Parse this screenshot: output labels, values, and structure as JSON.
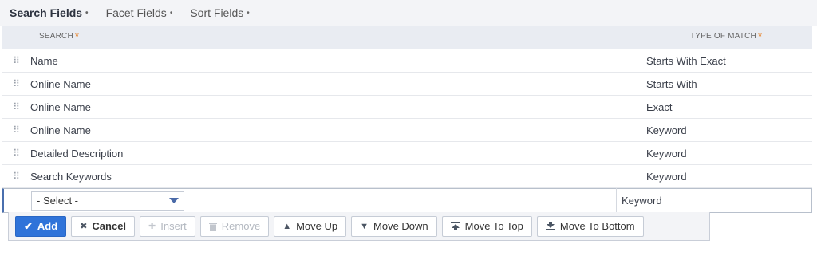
{
  "tabs": [
    {
      "label": "Search Fields",
      "active": true
    },
    {
      "label": "Facet Fields",
      "active": false
    },
    {
      "label": "Sort Fields",
      "active": false
    }
  ],
  "tab_dot": "•",
  "columns": {
    "search": "SEARCH",
    "type_of_match": "TYPE OF MATCH",
    "required_marker": "*"
  },
  "rows": [
    {
      "search": "Name",
      "type": "Starts With Exact"
    },
    {
      "search": "Online Name",
      "type": "Starts With"
    },
    {
      "search": "Online Name",
      "type": "Exact"
    },
    {
      "search": "Online Name",
      "type": "Keyword"
    },
    {
      "search": "Detailed Description",
      "type": "Keyword"
    },
    {
      "search": "Search Keywords",
      "type": "Keyword"
    }
  ],
  "edit_row": {
    "select_value": "- Select -",
    "type": "Keyword"
  },
  "toolbar": {
    "add": "Add",
    "cancel": "Cancel",
    "insert": "Insert",
    "remove": "Remove",
    "move_up": "Move Up",
    "move_down": "Move Down",
    "move_to_top": "Move To Top",
    "move_to_bottom": "Move To Bottom"
  },
  "colors": {
    "accent": "#2f73d9",
    "required": "#e67e22"
  }
}
